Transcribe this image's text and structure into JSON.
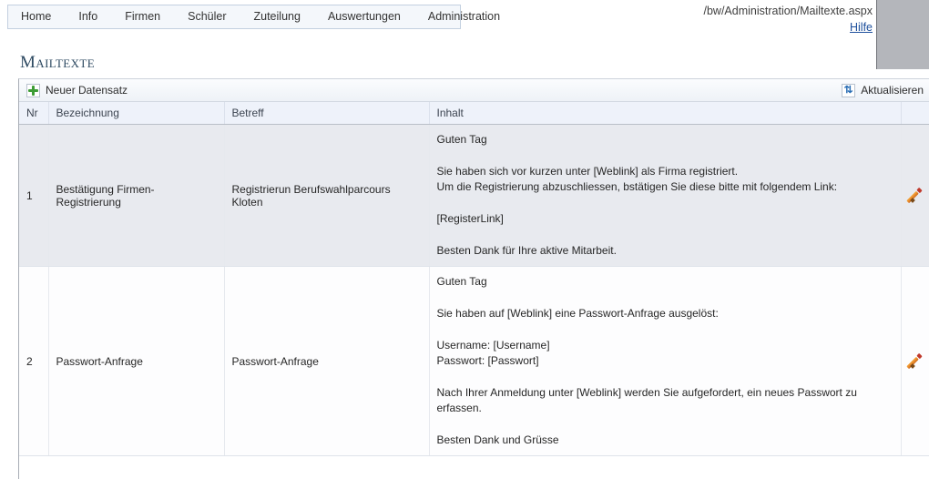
{
  "nav": {
    "items": [
      {
        "label": "Home",
        "name": "nav-item-home"
      },
      {
        "label": "Info",
        "name": "nav-item-info"
      },
      {
        "label": "Firmen",
        "name": "nav-item-firmen"
      },
      {
        "label": "Schüler",
        "name": "nav-item-schueler"
      },
      {
        "label": "Zuteilung",
        "name": "nav-item-zuteilung"
      },
      {
        "label": "Auswertungen",
        "name": "nav-item-auswertungen"
      },
      {
        "label": "Administration",
        "name": "nav-item-administration"
      }
    ]
  },
  "header": {
    "path": "/bw/Administration/Mailtexte.aspx",
    "help_label": "Hilfe"
  },
  "page": {
    "title": "Mailtexte"
  },
  "toolbar": {
    "new_record_label": "Neuer Datensatz",
    "new_record_icon": "plus-icon",
    "refresh_label": "Aktualisieren",
    "refresh_icon": "refresh-icon"
  },
  "grid": {
    "columns": [
      "Nr",
      "Bezeichnung",
      "Betreff",
      "Inhalt",
      ""
    ],
    "edit_icon": "pencil-icon",
    "rows": [
      {
        "nr": "1",
        "bezeichnung": "Bestätigung Firmen-Registrierung",
        "betreff": "Registrierun Berufswahlparcours Kloten",
        "inhalt": "Guten Tag\n\nSie haben sich vor kurzen unter [Weblink] als Firma registriert.\nUm die Registrierung abzuschliessen, bstätigen Sie diese bitte mit folgendem Link:\n\n[RegisterLink]\n\nBesten Dank für Ihre aktive Mitarbeit."
      },
      {
        "nr": "2",
        "bezeichnung": "Passwort-Anfrage",
        "betreff": "Passwort-Anfrage",
        "inhalt": "Guten Tag\n\nSie haben auf [Weblink] eine Passwort-Anfrage ausgelöst:\n\nUsername: [Username]\nPasswort: [Passwort]\n\nNach Ihrer Anmeldung unter [Weblink] werden Sie aufgefordert, ein neues Passwort zu erfassen.\n\nBesten Dank und Grüsse"
      }
    ]
  },
  "colors": {
    "nav_bg": "#f4f7fb",
    "nav_border": "#c3d0e0",
    "title": "#2e4a62",
    "link": "#1d4f9c",
    "row_alt_bg": "#e8eaef",
    "header_bg": "#eef2fa",
    "plus_green": "#3d9c35",
    "pencil_orange": "#e8862a",
    "right_block": "#b4b6bb"
  }
}
